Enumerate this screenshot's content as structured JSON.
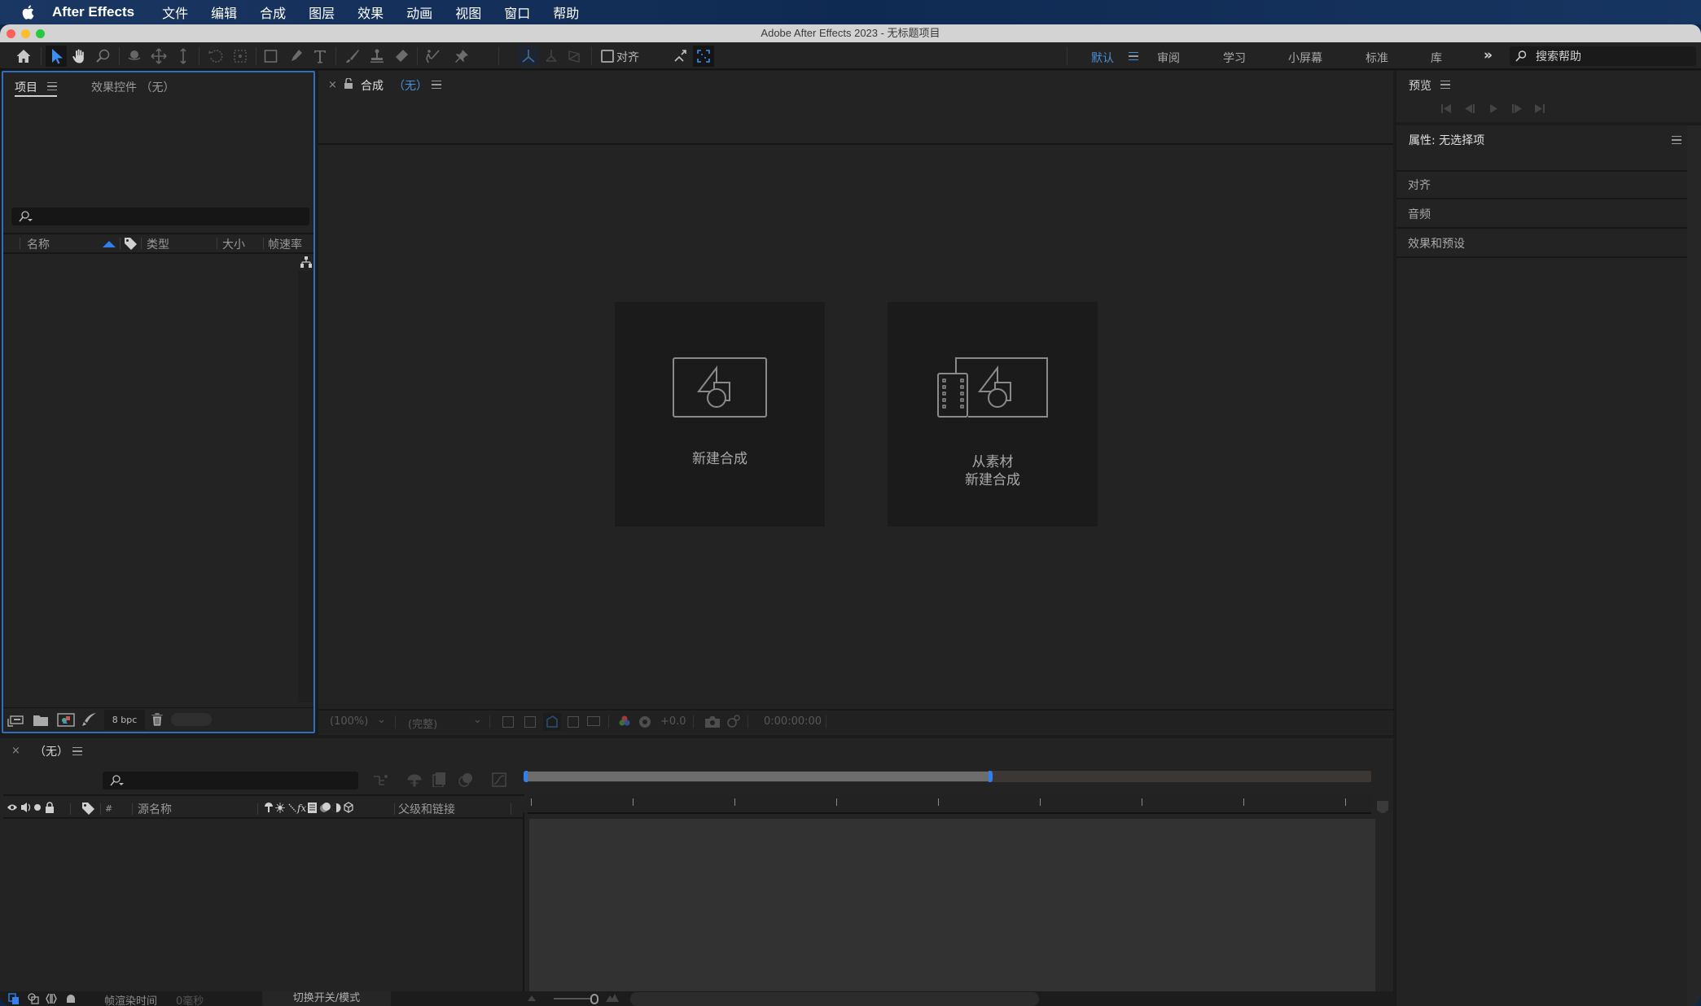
{
  "menubar": {
    "apple_icon": "apple-logo-icon",
    "app_name": "After Effects",
    "items": [
      "文件",
      "编辑",
      "合成",
      "图层",
      "效果",
      "动画",
      "视图",
      "窗口",
      "帮助"
    ]
  },
  "window": {
    "title": "Adobe After Effects 2023 - 无标题项目"
  },
  "toolbar": {
    "tools": [
      "home-icon",
      "selection-tool-icon",
      "hand-tool-icon",
      "zoom-tool-icon",
      "orbit-camera-icon",
      "pan-camera-icon",
      "dolly-camera-icon",
      "rotate-tool-icon",
      "pan-behind-icon",
      "rectangle-tool-icon",
      "pen-tool-icon",
      "type-tool-icon",
      "brush-tool-icon",
      "clone-stamp-icon",
      "eraser-icon",
      "roto-brush-icon",
      "puppet-pin-icon"
    ],
    "snap_label": "对齐",
    "workspaces": [
      {
        "label": "默认",
        "active": true
      },
      {
        "label": "审阅",
        "active": false
      },
      {
        "label": "学习",
        "active": false
      },
      {
        "label": "小屏幕",
        "active": false
      },
      {
        "label": "标准",
        "active": false
      },
      {
        "label": "库",
        "active": false
      }
    ],
    "overflow_label": "»",
    "help_search_placeholder": "搜索帮助"
  },
  "project_panel": {
    "tabs": [
      {
        "label": "项目",
        "active": true
      },
      {
        "label": "效果控件 （无）",
        "active": false
      }
    ],
    "columns": [
      "名称",
      "类型",
      "大小",
      "帧速率"
    ],
    "bpc_label": "8 bpc",
    "bottom_icons": [
      "interpret-footage-icon",
      "new-folder-icon",
      "new-composition-icon",
      "render-queue-icon",
      "trash-icon"
    ]
  },
  "composition_panel": {
    "tab_label": "合成",
    "tab_comp_name": "（无）",
    "cards": [
      {
        "label_lines": [
          "新建合成"
        ]
      },
      {
        "label_lines": [
          "从素材",
          "新建合成"
        ]
      }
    ],
    "footer": {
      "magnification": "(100%)",
      "resolution": "(完整)",
      "exposure": "+0.0",
      "timecode": "0:00:00:00"
    }
  },
  "preview_panel": {
    "title": "预览"
  },
  "properties_panel": {
    "title": "属性: 无选择项",
    "sections": [
      "对齐",
      "音频",
      "效果和预设"
    ]
  },
  "timeline_panel": {
    "tab_label": "（无）",
    "columns": {
      "number": "#",
      "source_name": "源名称",
      "parent": "父级和链接"
    },
    "work_area_fraction": 0.55,
    "footer": {
      "render_time_label": "帧渲染时间",
      "render_time_value": "0毫秒",
      "toggle_label": "切换开关/模式"
    }
  },
  "colors": {
    "accent": "#2f80ed",
    "workspace_active": "#4a90d9",
    "panel_bg": "#232323",
    "frame_bg": "#1b1b1b"
  }
}
